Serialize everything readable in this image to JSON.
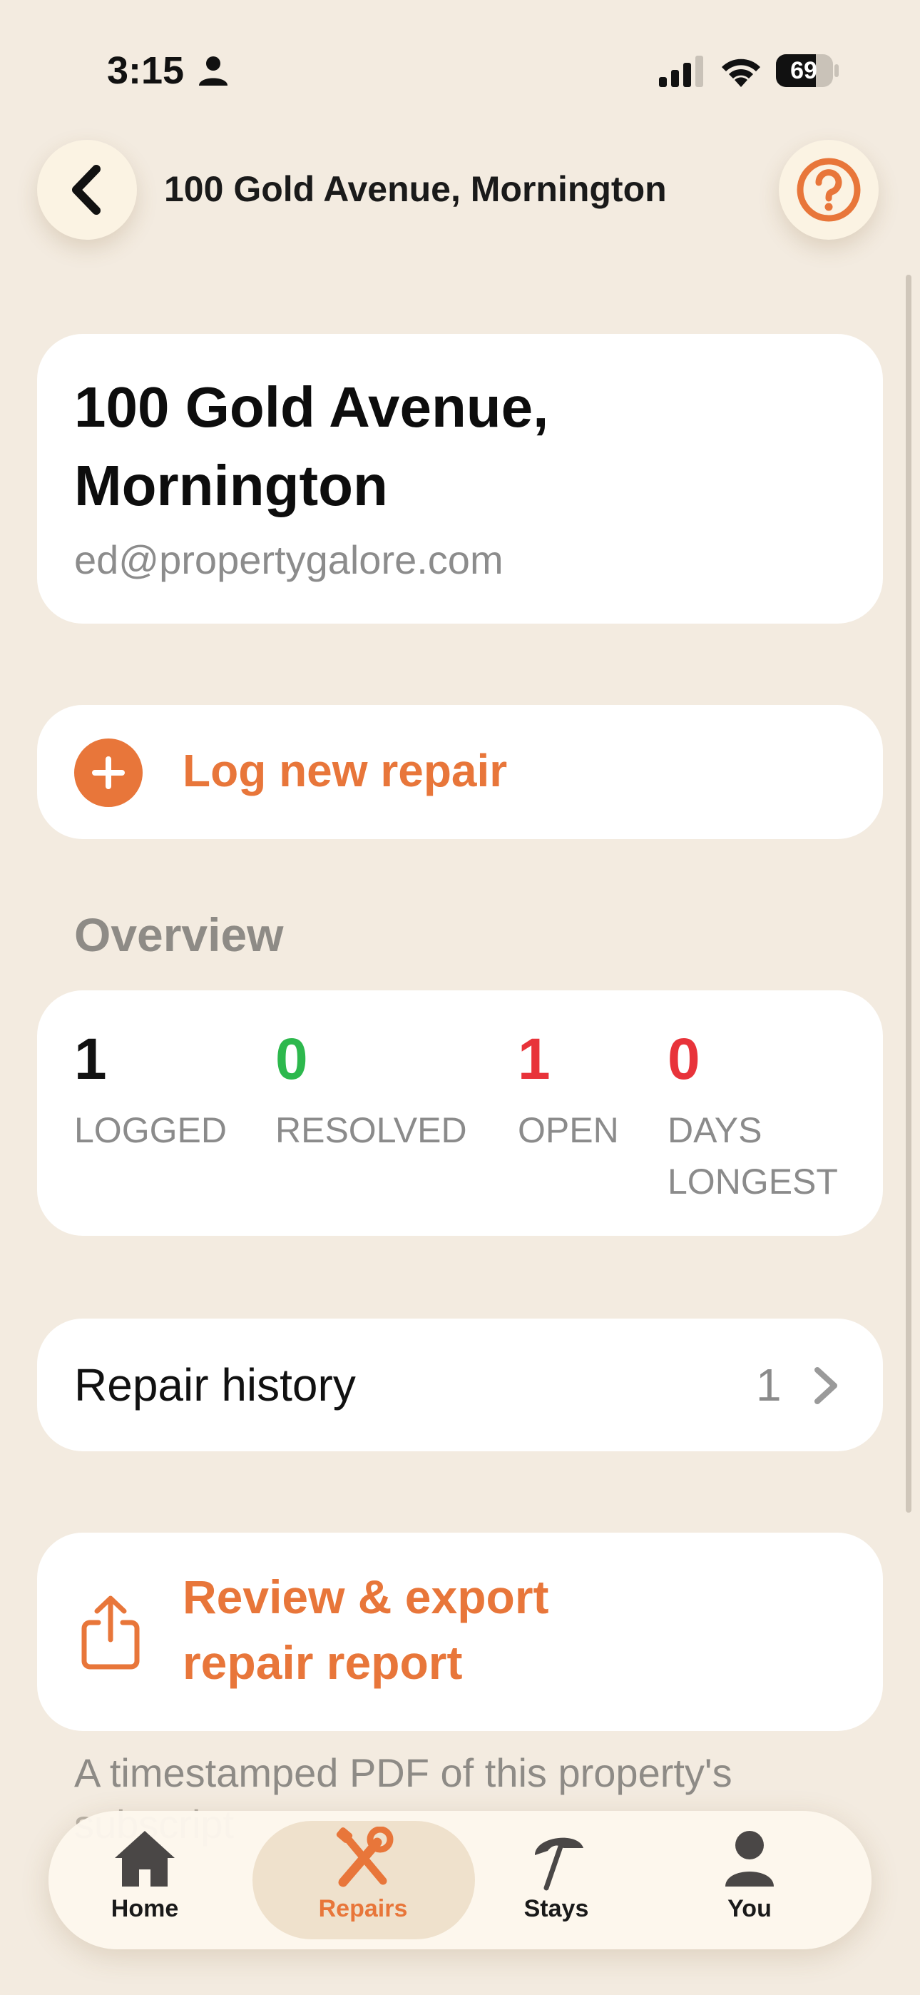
{
  "status_bar": {
    "time": "3:15",
    "battery": "69"
  },
  "header": {
    "title": "100 Gold Avenue, Mornington"
  },
  "property": {
    "title_line1": "100 Gold Avenue,",
    "title_line2": "Mornington",
    "email": "ed@propertygalore.com"
  },
  "log_repair": {
    "label": "Log new repair"
  },
  "overview": {
    "heading": "Overview",
    "stats": [
      {
        "value": "1",
        "label": "LOGGED",
        "color": "#111111"
      },
      {
        "value": "0",
        "label": "RESOLVED",
        "color": "#2db84d"
      },
      {
        "value": "1",
        "label": "OPEN",
        "color": "#e8333a"
      },
      {
        "value": "0",
        "label_line1": "DAYS",
        "label_line2": "LONGEST",
        "color": "#e8333a"
      }
    ]
  },
  "history": {
    "label": "Repair history",
    "count": "1"
  },
  "export": {
    "line1": "Review & export",
    "line2": "repair report"
  },
  "footnote": {
    "line1": "A timestamped PDF of this property's",
    "line2": "subscript"
  },
  "tabs": [
    {
      "label": "Home",
      "icon": "home-icon"
    },
    {
      "label": "Repairs",
      "icon": "wrench-screwdriver-icon",
      "active": true
    },
    {
      "label": "Stays",
      "icon": "umbrella-icon"
    },
    {
      "label": "You",
      "icon": "person-icon"
    }
  ],
  "colors": {
    "accent": "#e8763a",
    "background": "#f3ebe0",
    "green": "#2db84d",
    "red": "#e8333a"
  }
}
